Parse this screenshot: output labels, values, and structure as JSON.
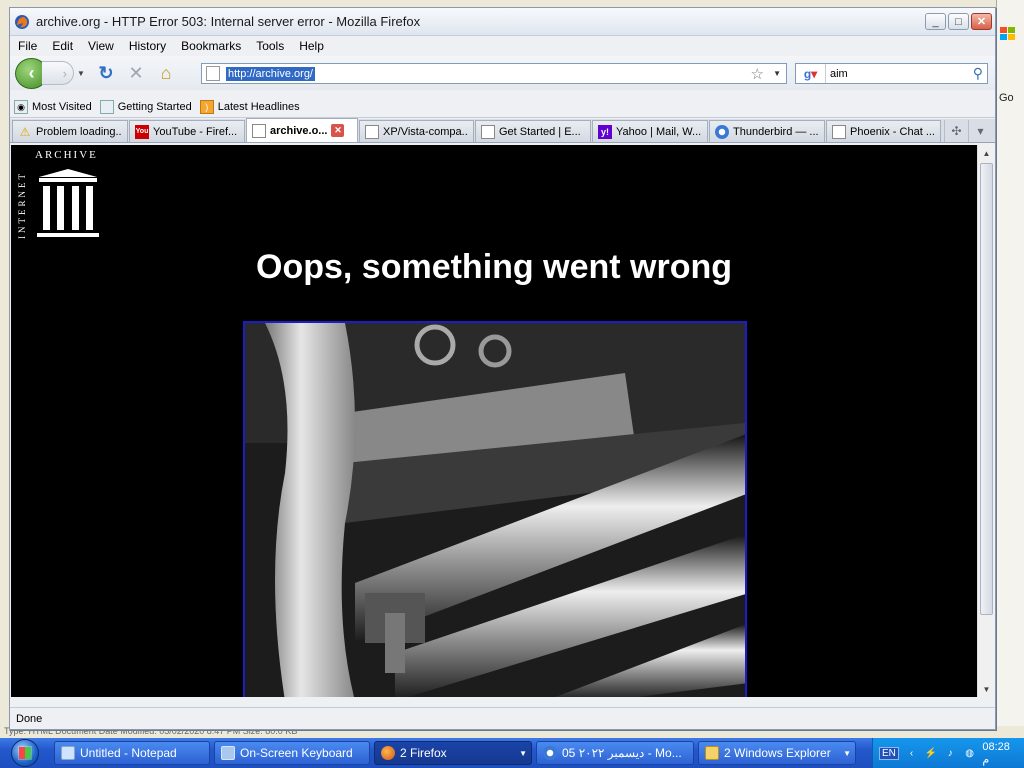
{
  "window": {
    "title": "archive.org - HTTP Error 503: Internal server error - Mozilla Firefox",
    "minimize": "_",
    "maximize": "□",
    "close": "✕"
  },
  "background": {
    "go_label": "Go",
    "bottom_text": "Type: HTML Document   Date Modified: 05/02/2020 8:47 PM   Size: 80.0 KB"
  },
  "menu": [
    "File",
    "Edit",
    "View",
    "History",
    "Bookmarks",
    "Tools",
    "Help"
  ],
  "nav": {
    "back_icon": "back-arrow-icon",
    "url": "http://archive.org/",
    "search_engine": "google-icon",
    "search_query": "aim"
  },
  "bookmarks": [
    {
      "label": "Most Visited",
      "icon": "most-visited-icon"
    },
    {
      "label": "Getting Started",
      "icon": "page-icon"
    },
    {
      "label": "Latest Headlines",
      "icon": "rss-icon"
    }
  ],
  "tabs": [
    {
      "label": "Problem loading...",
      "icon": "warning-icon",
      "active": false
    },
    {
      "label": "YouTube - Firef...",
      "icon": "youtube-icon",
      "active": false
    },
    {
      "label": "archive.o...",
      "icon": "page-icon",
      "active": true
    },
    {
      "label": "XP/Vista-compa...",
      "icon": "page-icon",
      "active": false
    },
    {
      "label": "Get Started | E...",
      "icon": "page-icon",
      "active": false
    },
    {
      "label": "Yahoo | Mail, W...",
      "icon": "yahoo-icon",
      "active": false
    },
    {
      "label": "Thunderbird — ...",
      "icon": "thunderbird-icon",
      "active": false
    },
    {
      "label": "Phoenix - Chat ...",
      "icon": "page-icon",
      "active": false
    }
  ],
  "content": {
    "logo_vertical": "INTERNET",
    "logo_horizontal": "ARCHIVE",
    "headline": "Oops, something went wrong"
  },
  "status": "Done",
  "taskbar": {
    "tasks": [
      {
        "label": "Untitled - Notepad",
        "icon": "notepad-icon"
      },
      {
        "label": "On-Screen Keyboard",
        "icon": "keyboard-icon"
      },
      {
        "label": "2 Firefox",
        "icon": "firefox-icon"
      },
      {
        "label": "05 ديسمبر ٢٠٢٢ - Mo...",
        "icon": "ie-icon"
      },
      {
        "label": "2 Windows Explorer",
        "icon": "folder-icon"
      }
    ],
    "lang": "EN",
    "clock": "08:28 م"
  }
}
